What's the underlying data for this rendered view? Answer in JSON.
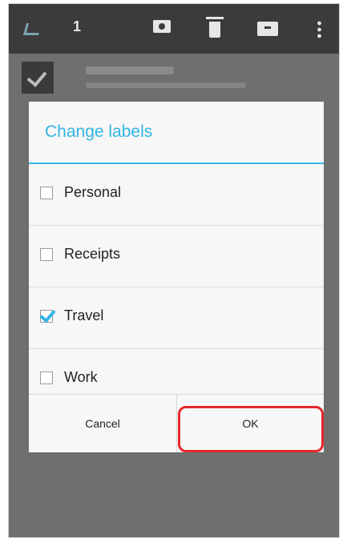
{
  "actionbar": {
    "selected_count": "1",
    "icons": [
      "back-icon",
      "label-icon",
      "delete-icon",
      "archive-icon",
      "overflow-icon"
    ]
  },
  "dialog": {
    "title": "Change labels",
    "items": [
      {
        "label": "Personal",
        "checked": false
      },
      {
        "label": "Receipts",
        "checked": false
      },
      {
        "label": "Travel",
        "checked": true
      },
      {
        "label": "Work",
        "checked": false
      }
    ],
    "cancel_label": "Cancel",
    "ok_label": "OK"
  },
  "colors": {
    "accent": "#33b5e5",
    "highlight": "#e5262c",
    "scrim": "#6f6f6f"
  }
}
